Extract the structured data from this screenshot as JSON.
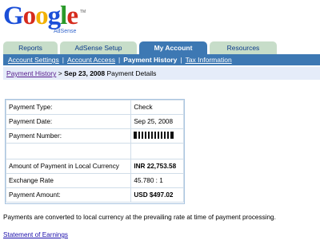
{
  "logo": {
    "word": "Google",
    "product": "AdSense",
    "trademark": "TM"
  },
  "tabs": [
    {
      "label": "Reports"
    },
    {
      "label": "AdSense Setup"
    },
    {
      "label": "My Account"
    },
    {
      "label": "Resources"
    }
  ],
  "subnav": {
    "items": [
      {
        "label": "Account Settings"
      },
      {
        "label": "Account Access"
      },
      {
        "label": "Payment History"
      },
      {
        "label": "Tax Information"
      }
    ],
    "separator": "|"
  },
  "breadcrumb": {
    "link": "Payment History",
    "separator": ">",
    "date": "Sep 23, 2008",
    "suffix": "Payment Details"
  },
  "details": [
    {
      "label": "Payment Type:",
      "value": "Check"
    },
    {
      "label": "Payment Date:",
      "value": "Sep 25, 2008"
    },
    {
      "label": "Payment Number:",
      "value": ""
    },
    {
      "label": "",
      "value": ""
    },
    {
      "label": "Amount of Payment in Local Currency",
      "value": "INR 22,753.58"
    },
    {
      "label": "Exchange Rate",
      "value": "45.780 : 1"
    },
    {
      "label": "Payment Amount:",
      "value": "USD $497.02"
    }
  ],
  "note": "Payments are converted to local currency at the prevailing rate at time of payment processing.",
  "statement_link": "Statement of Earnings",
  "colors": {
    "tab_active": "#3d78b3",
    "tab_inactive": "#c7ddc9",
    "crumb_bg": "#e5ecf9"
  }
}
